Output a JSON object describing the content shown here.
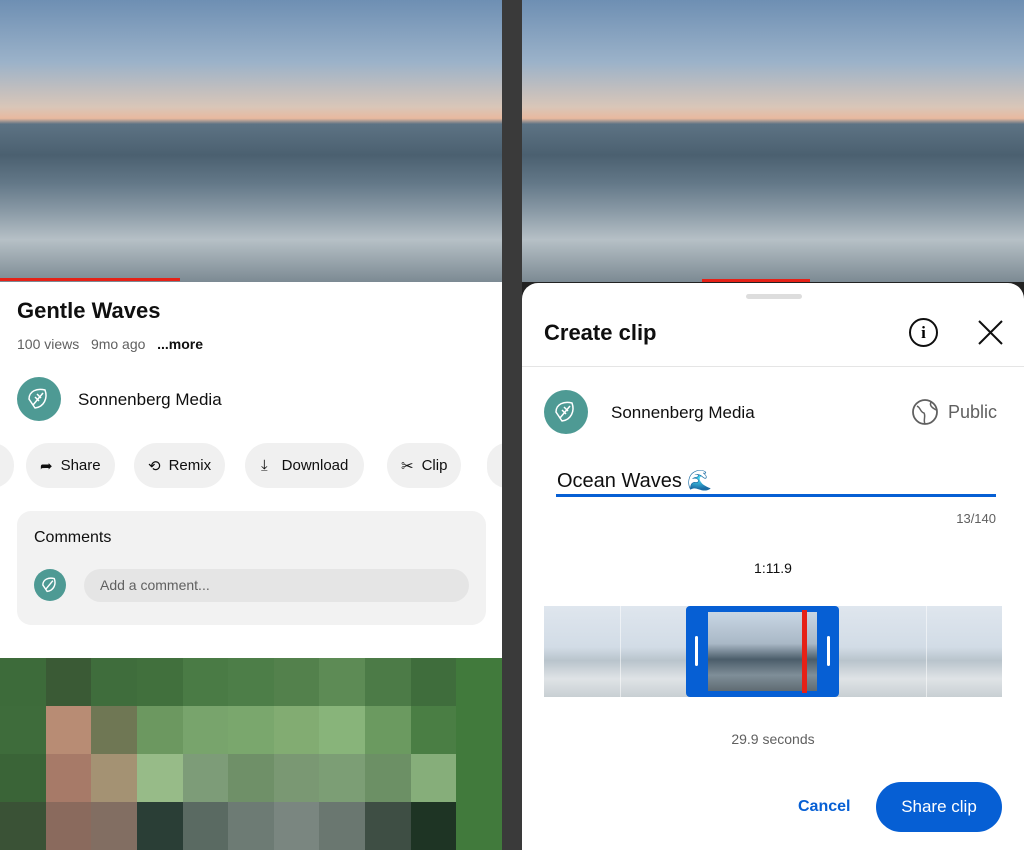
{
  "left": {
    "video": {
      "progress_percent": 36
    },
    "title": "Gentle Waves",
    "meta": {
      "views": "100 views",
      "age": "9mo ago",
      "more": "...more"
    },
    "channel": "Sonnenberg Media",
    "actions": [
      {
        "label": "Share",
        "icon": "share-icon"
      },
      {
        "label": "Remix",
        "icon": "remix-icon"
      },
      {
        "label": "Download",
        "icon": "download-icon"
      },
      {
        "label": "Clip",
        "icon": "scissors-icon"
      }
    ],
    "comments": {
      "heading": "Comments",
      "placeholder": "Add a comment..."
    }
  },
  "right": {
    "sheet": {
      "title": "Create clip",
      "channel": "Sonnenberg Media",
      "visibility": "Public",
      "clip_title": "Ocean Waves 🌊",
      "char_count": "13/140",
      "timestamp": "1:11.9",
      "duration": "29.9 seconds",
      "cancel": "Cancel",
      "share": "Share clip"
    }
  },
  "colors": {
    "accent": "#065fd4",
    "progress": "#e62117",
    "avatar": "#4e9a94"
  }
}
